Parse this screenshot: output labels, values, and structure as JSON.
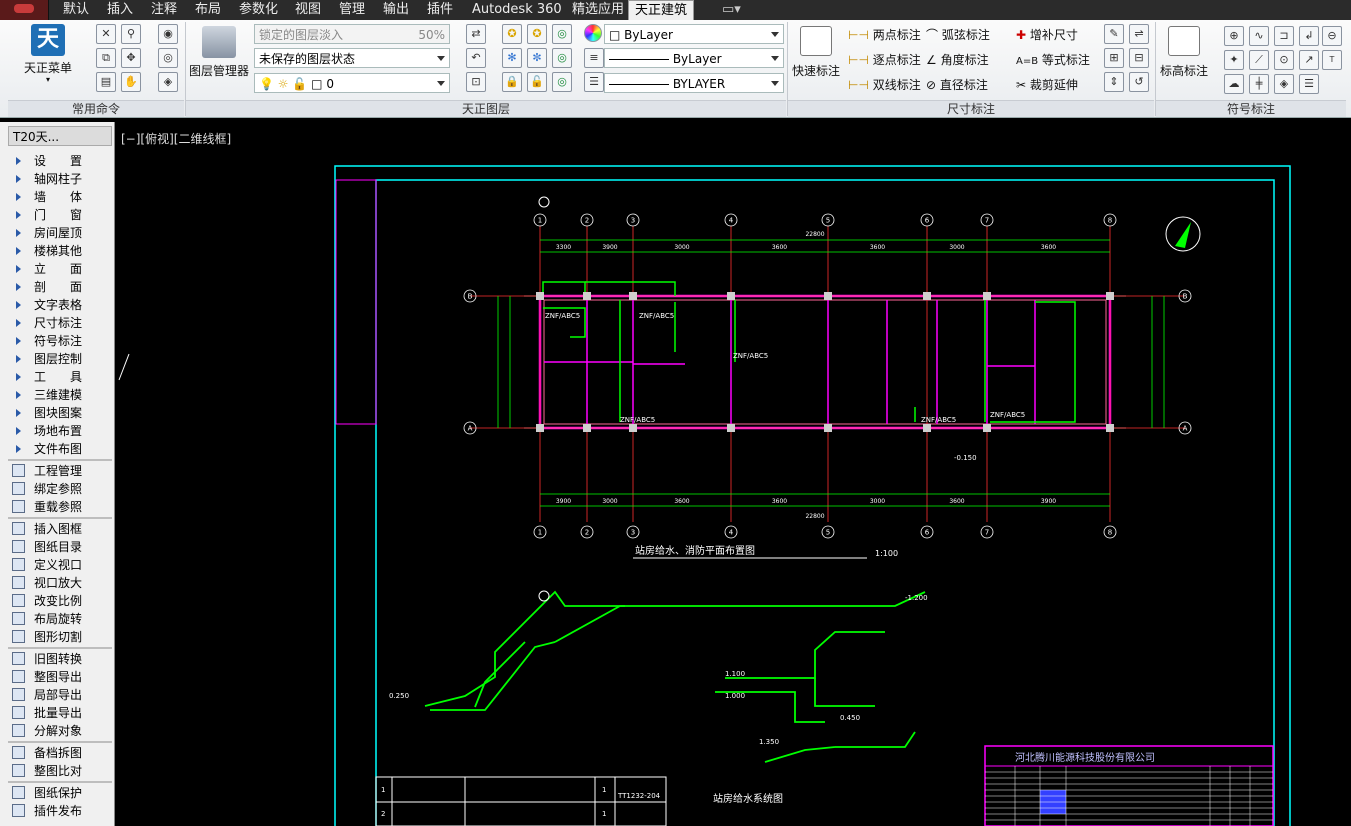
{
  "menubar": {
    "tabs": [
      "默认",
      "插入",
      "注释",
      "布局",
      "参数化",
      "视图",
      "管理",
      "输出",
      "插件",
      "Autodesk 360",
      "精选应用",
      "天正建筑"
    ],
    "active_tab": "天正建筑"
  },
  "ribbon": {
    "panel_common": {
      "title": "常用命令",
      "big_button": "天正菜单"
    },
    "panel_layer": {
      "title": "天正图层",
      "big_button": "图层管理器",
      "locked_fade_label": "锁定的图层淡入",
      "fade_value": "50%",
      "layer_state": "未保存的图层状态",
      "current_layer": "0",
      "color": "ByLayer",
      "linetype": "ByLayer",
      "lineweight": "BYLAYER"
    },
    "panel_dim": {
      "title": "尺寸标注",
      "big_button": "快速标注",
      "items": [
        "两点标注",
        "弧弦标注",
        "增补尺寸",
        "逐点标注",
        "角度标注",
        "等式标注",
        "双线标注",
        "直径标注",
        "裁剪延伸"
      ],
      "equal_prefix": "A=B"
    },
    "panel_symbol": {
      "title": "符号标注",
      "big_button": "标高标注"
    }
  },
  "sidebar": {
    "title": "T20天...",
    "groups": [
      [
        "设　　置",
        "轴网柱子",
        "墙　　体",
        "门　　窗",
        "房间屋顶",
        "楼梯其他",
        "立　　面",
        "剖　　面",
        "文字表格",
        "尺寸标注",
        "符号标注",
        "图层控制",
        "工　　具",
        "三维建模",
        "图块图案",
        "场地布置",
        "文件布图"
      ],
      [
        "工程管理",
        "绑定参照",
        "重载参照"
      ],
      [
        "插入图框",
        "图纸目录",
        "定义视口",
        "视口放大",
        "改变比例",
        "布局旋转",
        "图形切割"
      ],
      [
        "旧图转换",
        "整图导出",
        "局部导出",
        "批量导出",
        "分解对象"
      ],
      [
        "备档拆图",
        "整图比对"
      ],
      [
        "图纸保护",
        "插件发布"
      ]
    ]
  },
  "viewport": {
    "label": "[−][俯视][二维线框]",
    "plan_title": "站房给水、消防平面布置图",
    "plan_scale": "1:100",
    "system_title": "站房给水系统图",
    "titleblock_company": "河北腾川能源科技股份有限公司",
    "axes_top": [
      "1",
      "2",
      "3",
      "4",
      "5",
      "6",
      "7",
      "8"
    ],
    "axes_side": [
      "B",
      "A"
    ],
    "dim_total": "22800",
    "dim_items": [
      "3300",
      "3900",
      "3000",
      "3600",
      "3600",
      "3000",
      "3600",
      "3900",
      "3000"
    ],
    "pipe_labels": [
      "ZNF/ABC5",
      "ZNF/ABC5",
      "ZNF/ABC5",
      "ZNF/ABC5",
      "ZNF/ABC5",
      "ZNF/ABC5"
    ],
    "elevations": [
      "-0.150",
      "-1.200",
      "0.250",
      "1.100",
      "1.350",
      "0.450",
      "1.000"
    ],
    "table_values": [
      "1",
      "1",
      "2",
      "1"
    ],
    "table_code": "TT1232-204"
  },
  "colors": {
    "accent": "#1f6fb5",
    "cad_green": "#00ff00",
    "cad_cyan": "#00ffff",
    "cad_magenta": "#ff00ff",
    "cad_red": "#ff3030",
    "cad_white": "#ffffff"
  }
}
